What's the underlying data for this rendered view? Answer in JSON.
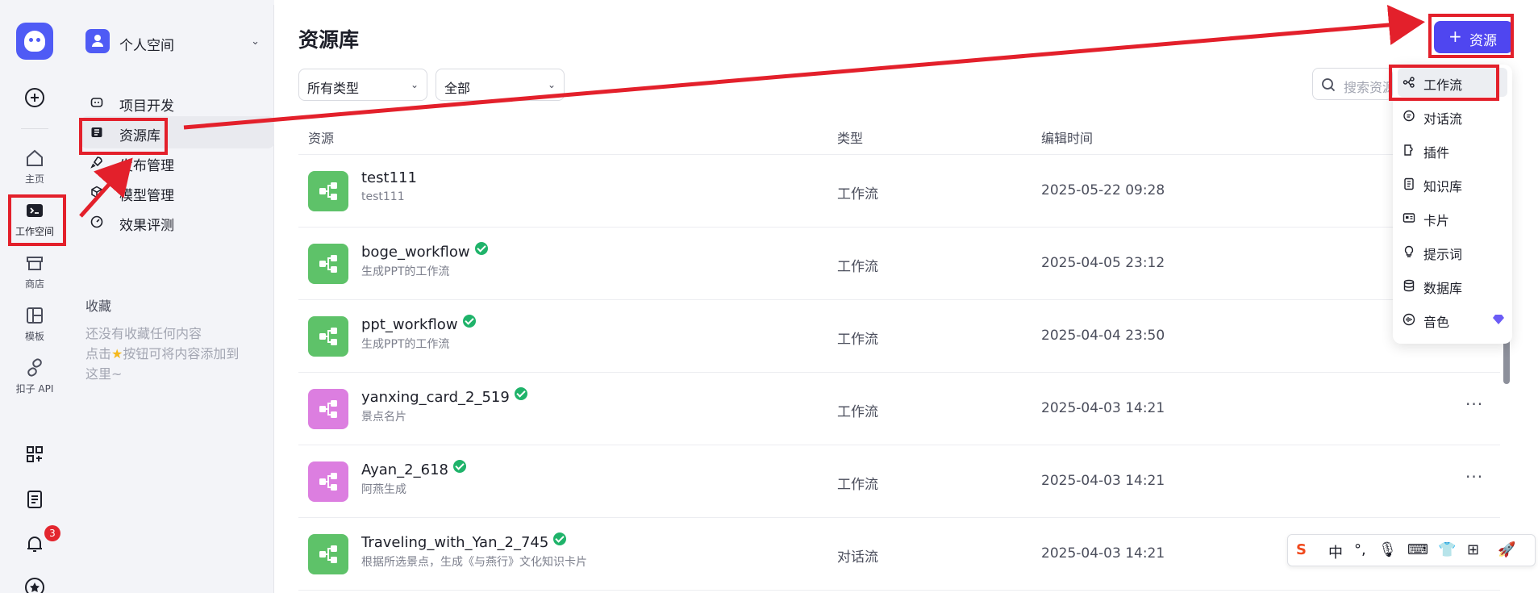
{
  "rail": {
    "items": [
      {
        "label": "主页"
      },
      {
        "label": "工作空间"
      },
      {
        "label": "商店"
      },
      {
        "label": "模板"
      },
      {
        "label": "扣子 API"
      }
    ],
    "notification_count": "3"
  },
  "sidebar": {
    "space_name": "个人空间",
    "nav": [
      {
        "label": "项目开发"
      },
      {
        "label": "资源库"
      },
      {
        "label": "发布管理"
      },
      {
        "label": "模型管理"
      },
      {
        "label": "效果评测"
      }
    ],
    "favorites_title": "收藏",
    "favorites_hint_1": "还没有收藏任何内容",
    "favorites_hint_2": "点击",
    "favorites_hint_3": "按钮可将内容添加到",
    "favorites_hint_4": "这里~"
  },
  "main": {
    "title": "资源库",
    "filter_type": "所有类型",
    "filter_scope": "全部",
    "search_placeholder": "搜索资源",
    "add_button": "资源",
    "columns": {
      "resource": "资源",
      "type": "类型",
      "edited": "编辑时间"
    },
    "rows": [
      {
        "name": "test111",
        "desc": "test111",
        "type": "工作流",
        "time": "2025-05-22 09:28",
        "verified": false,
        "color": "#5ec269"
      },
      {
        "name": "boge_workflow",
        "desc": "生成PPT的工作流",
        "type": "工作流",
        "time": "2025-04-05 23:12",
        "verified": true,
        "color": "#5ec269"
      },
      {
        "name": "ppt_workflow",
        "desc": "生成PPT的工作流",
        "type": "工作流",
        "time": "2025-04-04 23:50",
        "verified": true,
        "color": "#5ec269"
      },
      {
        "name": "yanxing_card_2_519",
        "desc": "景点名片",
        "type": "工作流",
        "time": "2025-04-03 14:21",
        "verified": true,
        "color": "#dc7ee0"
      },
      {
        "name": "Ayan_2_618",
        "desc": "阿燕生成",
        "type": "工作流",
        "time": "2025-04-03 14:21",
        "verified": true,
        "color": "#dc7ee0"
      },
      {
        "name": "Traveling_with_Yan_2_745",
        "desc": "根据所选景点，生成《与燕行》文化知识卡片",
        "type": "对话流",
        "time": "2025-04-03 14:21",
        "verified": true,
        "color": "#5ec269"
      }
    ]
  },
  "menu": {
    "items": [
      {
        "label": "工作流"
      },
      {
        "label": "对话流"
      },
      {
        "label": "插件"
      },
      {
        "label": "知识库"
      },
      {
        "label": "卡片"
      },
      {
        "label": "提示词"
      },
      {
        "label": "数据库"
      },
      {
        "label": "音色"
      }
    ]
  },
  "ime": {
    "mode": "中"
  },
  "colors": {
    "accent": "#4f46f0",
    "annotation": "#e3202b",
    "verified": "#1fb36a"
  }
}
